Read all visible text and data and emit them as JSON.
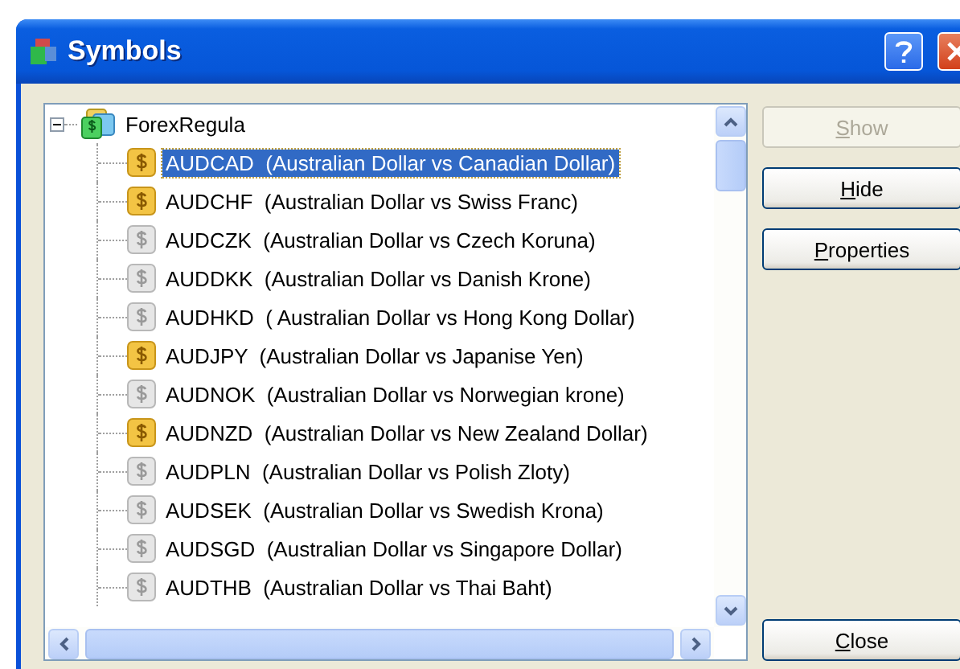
{
  "window": {
    "title": "Symbols"
  },
  "tree": {
    "root": {
      "label": "ForexRegula",
      "expanded": true
    },
    "items": [
      {
        "symbol": "AUDCAD",
        "description": "(Australian Dollar vs Canadian Dollar)",
        "shown": true,
        "selected": true
      },
      {
        "symbol": "AUDCHF",
        "description": "(Australian Dollar vs Swiss Franc)",
        "shown": true,
        "selected": false
      },
      {
        "symbol": "AUDCZK",
        "description": "(Australian Dollar vs Czech Koruna)",
        "shown": false,
        "selected": false
      },
      {
        "symbol": "AUDDKK",
        "description": "(Australian Dollar vs Danish Krone)",
        "shown": false,
        "selected": false
      },
      {
        "symbol": "AUDHKD",
        "description": "( Australian Dollar vs Hong Kong Dollar)",
        "shown": false,
        "selected": false
      },
      {
        "symbol": "AUDJPY",
        "description": "(Australian Dollar vs Japanise Yen)",
        "shown": true,
        "selected": false
      },
      {
        "symbol": "AUDNOK",
        "description": "(Australian Dollar vs Norwegian krone)",
        "shown": false,
        "selected": false
      },
      {
        "symbol": "AUDNZD",
        "description": "(Australian Dollar vs New Zealand Dollar)",
        "shown": true,
        "selected": false
      },
      {
        "symbol": "AUDPLN",
        "description": "(Australian Dollar vs Polish Zloty)",
        "shown": false,
        "selected": false
      },
      {
        "symbol": "AUDSEK",
        "description": "(Australian Dollar vs Swedish Krona)",
        "shown": false,
        "selected": false
      },
      {
        "symbol": "AUDSGD",
        "description": "(Australian Dollar vs Singapore Dollar)",
        "shown": false,
        "selected": false
      },
      {
        "symbol": "AUDTHB",
        "description": "(Australian Dollar vs Thai Baht)",
        "shown": false,
        "selected": false
      }
    ]
  },
  "buttons": [
    {
      "label": "Show",
      "disabled": true
    },
    {
      "label": "Hide",
      "disabled": false
    },
    {
      "label": "Properties",
      "disabled": false
    }
  ],
  "close_button": {
    "label": "Close",
    "disabled": false
  }
}
